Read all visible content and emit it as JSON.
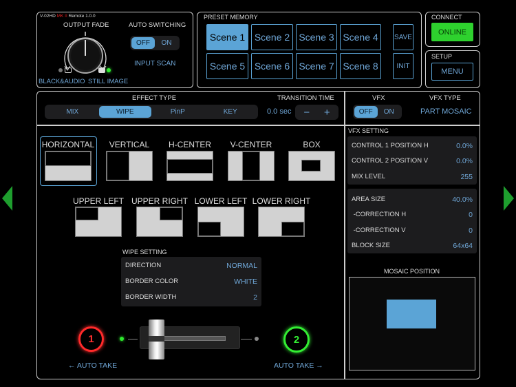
{
  "header": {
    "version_prefix": "V-02HD",
    "version_mk": "MK II",
    "version_suffix": "Remote 1.0.0",
    "output_fade": "OUTPUT FADE",
    "black_audio": "BLACK&AUDIO",
    "still_image": "STILL IMAGE",
    "auto_switching": "AUTO SWITCHING",
    "auto_off": "OFF",
    "auto_on": "ON",
    "auto_state": "OFF",
    "input_scan": "INPUT SCAN"
  },
  "preset": {
    "title": "PRESET MEMORY",
    "scenes": [
      "Scene 1",
      "Scene 2",
      "Scene 3",
      "Scene 4",
      "Scene 5",
      "Scene 6",
      "Scene 7",
      "Scene 8"
    ],
    "selected": "Scene 1",
    "save": "SAVE",
    "init": "INIT"
  },
  "connect": {
    "title": "CONNECT",
    "button": "ONLINE"
  },
  "setup": {
    "title": "SETUP",
    "button": "MENU"
  },
  "effect": {
    "title": "EFFECT TYPE",
    "types": [
      "MIX",
      "WIPE",
      "PinP",
      "KEY"
    ],
    "selected": "WIPE",
    "transition_title": "TRANSITION TIME",
    "transition_value": "0.0 sec",
    "minus": "−",
    "plus": "+"
  },
  "wipe": {
    "patterns": [
      "HORIZONTAL",
      "VERTICAL",
      "H-CENTER",
      "V-CENTER",
      "BOX",
      "UPPER LEFT",
      "UPPER RIGHT",
      "LOWER LEFT",
      "LOWER RIGHT"
    ],
    "selected": "HORIZONTAL",
    "setting_title": "WIPE SETTING",
    "settings": [
      {
        "label": "DIRECTION",
        "value": "NORMAL"
      },
      {
        "label": "BORDER COLOR",
        "value": "WHITE"
      },
      {
        "label": "BORDER WIDTH",
        "value": "2"
      }
    ]
  },
  "fader": {
    "ch1": "1",
    "ch2": "2",
    "auto_take_left": "← AUTO TAKE",
    "auto_take_right": "AUTO TAKE →",
    "position": 0
  },
  "vfx": {
    "title": "VFX",
    "off": "OFF",
    "on": "ON",
    "state": "OFF",
    "type_title": "VFX TYPE",
    "type": "PART MOSAIC",
    "setting_title": "VFX SETTING",
    "group1": [
      {
        "label": "CONTROL 1 POSITION H",
        "value": "0.0%"
      },
      {
        "label": "CONTROL 2 POSITION V",
        "value": "0.0%"
      },
      {
        "label": "MIX LEVEL",
        "value": "255"
      }
    ],
    "group2": [
      {
        "label": "AREA SIZE",
        "value": "40.0%"
      },
      {
        "label": " -CORRECTION H",
        "value": "0"
      },
      {
        "label": " -CORRECTION V",
        "value": "0"
      },
      {
        "label": "BLOCK SIZE",
        "value": "64x64"
      }
    ],
    "mosaic_title": "MOSAIC POSITION"
  },
  "colors": {
    "accent": "#5ba4d6",
    "online": "#2ed12e",
    "ch1": "#ff2a2a",
    "ch2": "#33ee33",
    "nav_arrow": "#1e9e2e"
  }
}
